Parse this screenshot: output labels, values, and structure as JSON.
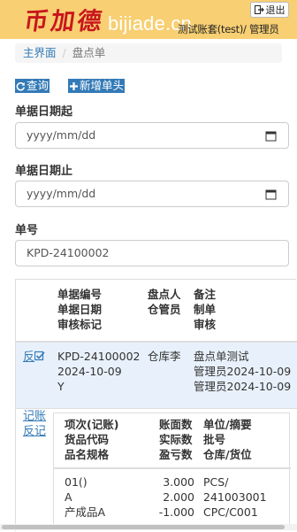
{
  "header": {
    "logo_cn": "币加德",
    "logo_en": "bijiade.cn",
    "user_info": "测试账套(test)/ 管理员",
    "logout_label": "退出"
  },
  "breadcrumb": {
    "home": "主界面",
    "separator": "/",
    "current": "盘点单"
  },
  "toolbar": {
    "query_label": "查询",
    "add_label": "新增单头"
  },
  "form": {
    "date_from_label": "单据日期起",
    "date_from_placeholder": "yyyy/mm/dd",
    "date_to_label": "单据日期止",
    "date_to_placeholder": "yyyy/mm/dd",
    "doc_no_label": "单号",
    "doc_no_value": "KPD-24100002"
  },
  "table": {
    "headers": {
      "col1": [
        "单据编号",
        "单据日期",
        "审核标记"
      ],
      "col2": [
        "盘点人",
        "仓管员"
      ],
      "col3": [
        "备注",
        "制单",
        "审核"
      ]
    },
    "rows": [
      {
        "action_label": "反",
        "col1": [
          "KPD-24100002",
          "2024-10-09",
          "Y"
        ],
        "col2": [
          "仓库李"
        ],
        "col3": [
          "盘点单测试",
          "管理员2024-10-09",
          "管理员2024-10-09"
        ]
      }
    ],
    "detail_actions": [
      "记账",
      "反记"
    ],
    "detail_headers": {
      "col1": [
        "项次(记账)",
        "货品代码",
        "品名规格"
      ],
      "col2": [
        "账面数",
        "实际数",
        "盈亏数"
      ],
      "col3": [
        "单位/摘要",
        "批号",
        "仓库/货位"
      ]
    },
    "detail_rows": [
      {
        "col1": [
          "01()",
          "A",
          "产成品A"
        ],
        "col2": [
          "3.000",
          "2.000",
          "-1.000"
        ],
        "col3": [
          "PCS/",
          "241003001",
          "CPC/C001"
        ]
      }
    ]
  }
}
